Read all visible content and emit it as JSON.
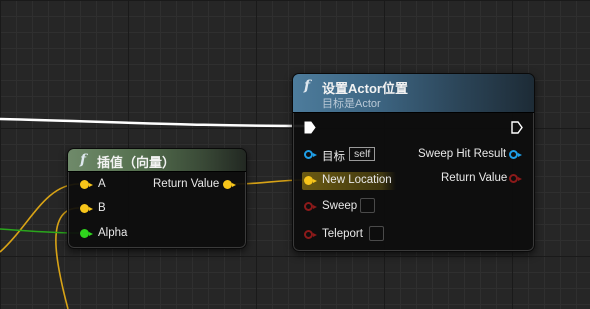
{
  "interp_node": {
    "glyph": "f",
    "title": "插值（向量）",
    "inputs": [
      "A",
      "B",
      "Alpha"
    ],
    "output": "Return Value"
  },
  "setloc_node": {
    "glyph": "f",
    "title": "设置Actor位置",
    "subtitle": "目标是Actor",
    "inputs": {
      "target": "目标",
      "target_value": "self",
      "new_location": "New Location",
      "sweep": "Sweep",
      "teleport": "Teleport"
    },
    "outputs": {
      "sweep_hit_result": "Sweep Hit Result",
      "return_value": "Return Value"
    }
  },
  "colors": {
    "vector_pin": "#f7c51a",
    "float_pin": "#2fd51d",
    "object_pin": "#1f9fe8",
    "struct_pin": "#8c1a1a",
    "exec_wire": "#ffffff"
  },
  "icons": [
    "function-icon",
    "exec-pin-icon"
  ]
}
